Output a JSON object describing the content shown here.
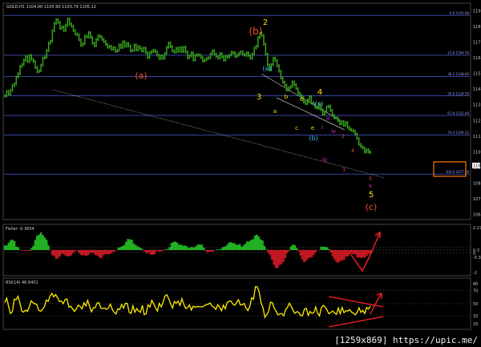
{
  "colors": {
    "background": "#000000",
    "price": "#3caa1e",
    "fib_line": "#5a6cff",
    "trend_line": "#c0c0c0",
    "wave_red": "#e8502a",
    "wave_yellow": "#ffe000",
    "wave_cyan": "#3fb6ff",
    "wave_magenta": "#e23bd9",
    "fisher_up": "#22b022",
    "fisher_down": "#c01822",
    "rsi": "#ffee00",
    "annotation_red": "#ff2020",
    "highlight_box": "#ff7a00"
  },
  "chart_data": [
    {
      "type": "line",
      "name": "price",
      "symbol_text": "GOLD,H1  1104.00 1105.90 1103.79 1105.12",
      "ylim": [
        1065,
        1195
      ],
      "y_ticks": [
        "119",
        "118",
        "117",
        "116",
        "115",
        "114",
        "113",
        "112",
        "111",
        "110",
        "109",
        "108",
        "107",
        "106"
      ],
      "current_price_label": "110",
      "values": [
        1140.0,
        1142.7,
        1141.2,
        1143.5,
        1146.3,
        1147.4,
        1151.6,
        1153.6,
        1158.1,
        1159.4,
        1162.0,
        1164.3,
        1161.1,
        1164.8,
        1162.4,
        1161.1,
        1157.5,
        1154.8,
        1155.5,
        1158.9,
        1163.2,
        1163.8,
        1167.9,
        1172.4,
        1173.6,
        1180.1,
        1184.6,
        1186.8,
        1185.1,
        1181.6,
        1182.4,
        1180.2,
        1183.5,
        1187.2,
        1184.2,
        1182.9,
        1180.2,
        1178.1,
        1177.5,
        1174.4,
        1171.1,
        1172.1,
        1176.7,
        1176.2,
        1178.9,
        1176.0,
        1172.4,
        1170.9,
        1174.6,
        1176.9,
        1176.3,
        1174.8,
        1173.4,
        1171.7,
        1169.9,
        1170.5,
        1168.7,
        1169.6,
        1167.5,
        1168.0,
        1171.4,
        1169.8,
        1173.3,
        1170.6,
        1172.2,
        1170.6,
        1167.7,
        1168.0,
        1171.3,
        1168.3,
        1170.3,
        1169.1,
        1167.6,
        1169.4,
        1166.5,
        1163.6,
        1166.5,
        1167.3,
        1168.0,
        1167.1,
        1165.0,
        1163.0,
        1164.6,
        1163.2,
        1166.1,
        1169.9,
        1172.5,
        1170.3,
        1167.6,
        1166.9,
        1169.3,
        1167.5,
        1169.6,
        1167.3,
        1170.0,
        1167.0,
        1163.5,
        1164.6,
        1166.4,
        1162.1,
        1164.9,
        1165.3,
        1165.0,
        1163.6,
        1161.5,
        1162.2,
        1163.1,
        1163.5,
        1165.8,
        1167.7,
        1165.7,
        1164.3,
        1163.2,
        1166.0,
        1164.0,
        1162.0,
        1164.4,
        1163.9,
        1165.1,
        1166.8,
        1166.4,
        1164.2,
        1165.1,
        1166.3,
        1167.1,
        1165.5,
        1165.0,
        1166.4,
        1164.8,
        1163.2,
        1165.8,
        1169.4,
        1170.6,
        1175.9,
        1178.5,
        1177.0,
        1171.8,
        1165.6,
        1159.1,
        1156.1,
        1159.2,
        1163.2,
        1161.8,
        1158.5,
        1155.2,
        1151.0,
        1148.5,
        1146.6,
        1143.6,
        1144.8,
        1145.7,
        1148.6,
        1146.9,
        1144.5,
        1141.7,
        1140.3,
        1138.8,
        1136.2,
        1135.3,
        1137.5,
        1139.6,
        1135.7,
        1135.0,
        1133.0,
        1132.5,
        1134.8,
        1131.6,
        1128.6,
        1130.1,
        1133.2,
        1133.7,
        1131.1,
        1128.0,
        1126.5,
        1126.4,
        1124.7,
        1122.8,
        1124.2,
        1122.0,
        1123.6,
        1120.6,
        1119.4,
        1118.9,
        1118.3,
        1116.6,
        1113.9,
        1110.2,
        1108.8,
        1108.0,
        1105.6,
        1106.9,
        1105.6,
        1105.1
      ]
    },
    {
      "type": "area",
      "name": "fisher",
      "title": "Fisher -0.3654",
      "ylim": [
        -2.5,
        2.5
      ],
      "y_ticks": [
        "2.27",
        "0.3",
        "0",
        "-0.3",
        "-2"
      ],
      "values": [
        0.48,
        0.47,
        0.76,
        0.99,
        1.08,
        0.93,
        0.35,
        0.3,
        -0.05,
        -0.04,
        -0.07,
        -0.09,
        -0.06,
        -0.11,
        0.2,
        0.43,
        1.05,
        1.47,
        1.6,
        1.82,
        1.57,
        1.31,
        1.04,
        0.47,
        -0.01,
        -0.53,
        -0.61,
        -0.93,
        -0.85,
        -0.64,
        -0.41,
        -0.42,
        -0.58,
        -0.66,
        -0.64,
        -0.56,
        -0.31,
        -0.12,
        -0.04,
        -0.23,
        -0.49,
        -0.56,
        -0.53,
        -0.62,
        -0.53,
        -0.3,
        -0.27,
        -0.37,
        -0.53,
        -0.6,
        -0.77,
        -0.84,
        -0.53,
        -0.43,
        -0.43,
        -0.45,
        -0.36,
        -0.2,
        -0.14,
        -0.02,
        0.24,
        0.3,
        0.41,
        0.53,
        0.86,
        1.15,
        1.11,
        1.07,
        0.67,
        0.53,
        0.38,
        0.27,
        0.2,
        -0.09,
        -0.2,
        -0.35,
        -0.21,
        -0.48,
        -0.49,
        -0.44,
        -0.12,
        -0.12,
        -0.17,
        -0.12,
        0.04,
        0.05,
        0.1,
        0.3,
        0.73,
        0.84,
        0.87,
        0.76,
        0.53,
        0.58,
        0.45,
        0.48,
        0.37,
        0.21,
        0.3,
        0.3,
        0.27,
        0.43,
        0.58,
        0.56,
        0.55,
        0.25,
        -0.11,
        -0.23,
        -0.18,
        -0.18,
        -0.17,
        0.01,
        0.09,
        0.05,
        0.12,
        0.29,
        0.35,
        0.48,
        0.71,
        0.83,
        0.73,
        0.72,
        0.58,
        0.52,
        0.63,
        0.33,
        0.49,
        0.66,
        0.92,
        0.88,
        1.06,
        1.12,
        1.49,
        1.59,
        1.42,
        1.11,
        0.99,
        0.42,
        0.06,
        -0.26,
        -0.52,
        -0.98,
        -1.52,
        -1.88,
        -1.87,
        -1.56,
        -1.48,
        -1.22,
        -0.83,
        -0.33,
        -0.11,
        0.37,
        0.56,
        0.51,
        0.22,
        -0.12,
        -0.57,
        -0.98,
        -1.27,
        -1.12,
        -0.9,
        -0.8,
        -0.75,
        -0.52,
        -0.24,
        -0.04,
        0.0,
        0.37,
        0.32,
        0.34,
        0.3,
        0.11,
        -0.25,
        -0.65,
        -0.97,
        -1.24,
        -1.31,
        -1.16,
        -1.1,
        -1.01,
        -0.69,
        -0.65,
        -0.48,
        -0.39,
        -0.45,
        -0.43,
        -0.75,
        -0.8,
        -0.82,
        -0.8,
        -0.77,
        -0.6,
        -0.4,
        -0.37
      ]
    },
    {
      "type": "line",
      "name": "rsi",
      "title": "RSI(14) 46.6401",
      "ylim": [
        14,
        86
      ],
      "y_ticks": [
        "80",
        "70",
        "50",
        "32",
        "20"
      ],
      "values": [
        51.6,
        58.4,
        46.3,
        35.5,
        37.8,
        56.8,
        55.9,
        61.2,
        51.5,
        39.1,
        37.5,
        40.4,
        38.5,
        45.5,
        54.3,
        51.2,
        50.0,
        48.8,
        39.9,
        38.9,
        41.8,
        45.2,
        55.5,
        53.6,
        61.4,
        65.5,
        60.3,
        63.8,
        58.9,
        53.3,
        54.1,
        50.2,
        56.4,
        57.0,
        44.8,
        46.3,
        42.1,
        38.5,
        42.5,
        47.9,
        45.8,
        42.3,
        51.4,
        46.8,
        55.0,
        45.8,
        37.9,
        44.0,
        44.2,
        51.2,
        51.4,
        43.2,
        42.8,
        43.4,
        41.5,
        43.7,
        49.4,
        41.5,
        37.1,
        34.7,
        42.4,
        41.4,
        48.8,
        43.5,
        50.7,
        50.5,
        37.1,
        35.6,
        46.9,
        37.3,
        42.7,
        39.0,
        37.2,
        47.6,
        33.7,
        35.0,
        48.3,
        45.0,
        55.1,
        50.0,
        43.7,
        38.9,
        50.5,
        45.3,
        52.1,
        61.6,
        63.4,
        57.4,
        49.7,
        43.7,
        53.2,
        50.7,
        53.9,
        47.4,
        57.5,
        48.9,
        43.0,
        44.3,
        48.2,
        40.5,
        46.3,
        44.5,
        45.7,
        45.6,
        45.5,
        45.6,
        47.2,
        48.6,
        49.4,
        51.0,
        46.5,
        44.9,
        41.5,
        48.5,
        45.0,
        39.6,
        47.9,
        42.3,
        51.9,
        53.6,
        54.1,
        49.5,
        47.6,
        51.8,
        56.1,
        48.2,
        48.4,
        50.3,
        43.7,
        39.6,
        45.9,
        58.8,
        56.8,
        75.7,
        75.2,
        67.6,
        51.0,
        44.4,
        29.6,
        33.8,
        38.4,
        52.4,
        51.5,
        43.4,
        38.7,
        33.1,
        34.9,
        35.4,
        31.7,
        41.1,
        44.5,
        50.7,
        46.0,
        39.6,
        35.5,
        38.2,
        37.1,
        32.2,
        32.2,
        42.1,
        43.1,
        32.6,
        38.4,
        35.6,
        36.6,
        45.0,
        35.9,
        31.8,
        44.1,
        47.4,
        45.0,
        40.3,
        35.1,
        36.8,
        39.0,
        36.3,
        34.2,
        43.7,
        35.1,
        44.4,
        36.6,
        39.6,
        39.0,
        41.3,
        37.4,
        35.8,
        33.4,
        37.2,
        43.8,
        37.0,
        40.0,
        35.2,
        44.3,
        42.1,
        46.6
      ]
    }
  ],
  "fib_levels": [
    {
      "text": "0.0 1191.68",
      "price": 1189.5
    },
    {
      "text": "23.6 1164.70",
      "price": 1165.0
    },
    {
      "text": "38.2 1148.00",
      "price": 1152.0
    },
    {
      "text": "50.0 1134.50",
      "price": 1140.0
    },
    {
      "text": "61.8 1121.00",
      "price": 1128.0
    },
    {
      "text": "76.4 1104.32",
      "price": 1116.0
    },
    {
      "text": "100.0 1077.26",
      "price": 1092.0
    }
  ],
  "wave_labels": [
    {
      "text": "(a)",
      "color": "wave_red"
    },
    {
      "text": "(b)",
      "color": "wave_red"
    },
    {
      "text": "(c)",
      "color": "wave_red"
    },
    {
      "text": "2",
      "color": "wave_yellow"
    },
    {
      "text": "3",
      "color": "wave_yellow"
    },
    {
      "text": "4",
      "color": "wave_yellow"
    },
    {
      "text": "5",
      "color": "wave_yellow"
    },
    {
      "text": "(a)",
      "color": "wave_cyan"
    },
    {
      "text": "(b)",
      "color": "wave_cyan"
    },
    {
      "text": "(c)",
      "color": "wave_cyan"
    },
    {
      "text": "a",
      "color": "wave_yellow"
    },
    {
      "text": "b",
      "color": "wave_yellow"
    },
    {
      "text": "c",
      "color": "wave_yellow"
    },
    {
      "text": "d",
      "color": "wave_yellow"
    },
    {
      "text": "e",
      "color": "wave_yellow"
    },
    {
      "text": "i",
      "color": "wave_magenta"
    },
    {
      "text": "ii",
      "color": "wave_magenta"
    },
    {
      "text": "iii",
      "color": "wave_magenta"
    },
    {
      "text": "iv",
      "color": "wave_magenta"
    },
    {
      "text": "v",
      "color": "wave_magenta"
    },
    {
      "text": "2",
      "color": "wave_red"
    },
    {
      "text": "3",
      "color": "wave_red"
    },
    {
      "text": "4",
      "color": "wave_red"
    },
    {
      "text": "5",
      "color": "wave_red"
    }
  ],
  "footer": "[1259x869] https://upic.me/"
}
